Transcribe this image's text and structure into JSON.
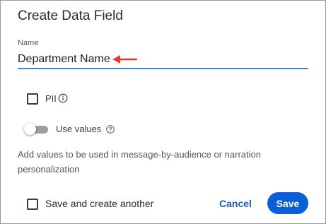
{
  "dialog": {
    "title": "Create Data Field"
  },
  "name_field": {
    "label": "Name",
    "value": "Department Name",
    "arrow_color": "#e53935",
    "underline_color": "#4a86c5"
  },
  "pii": {
    "label": "PII",
    "checked": false,
    "icon": "info-icon"
  },
  "use_values": {
    "label": "Use values",
    "enabled": false,
    "icon": "help-circle-icon"
  },
  "help_text": "Add values to be used in message-by-audience or narration personalization",
  "footer": {
    "save_another_label": "Save and create another",
    "save_another_checked": false,
    "cancel_label": "Cancel",
    "save_label": "Save",
    "accent_color": "#0b5ed7"
  }
}
